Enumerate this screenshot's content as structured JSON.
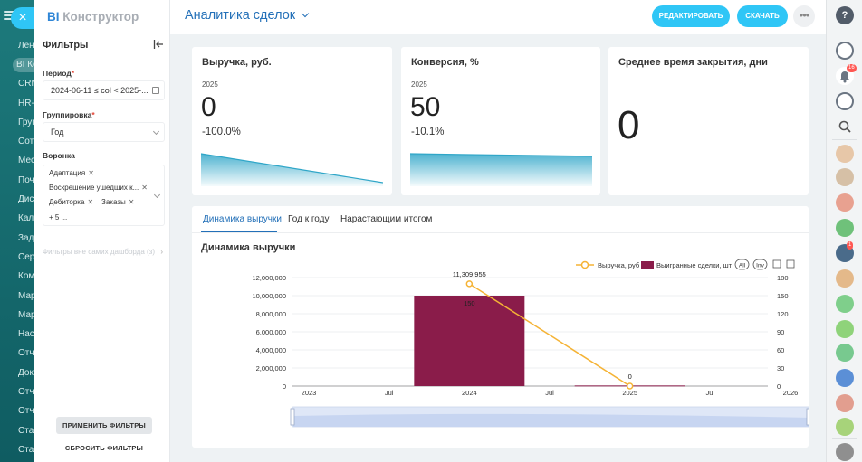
{
  "left_nav": {
    "items": [
      "Лент",
      "BI Ко",
      "CRM",
      "HR-А",
      "Груп",
      "Сотр",
      "Месс",
      "Почт",
      "Диск",
      "Кале",
      "Зада",
      "Серв",
      "Комп",
      "Марк",
      "Марк",
      "Наст",
      "Отче",
      "Доку",
      "Отче",
      "Отче",
      "Стан",
      "Стан"
    ],
    "active_index": 1
  },
  "close_button": "×",
  "filters": {
    "brand_prefix": "BI",
    "brand_name": "Конструктор",
    "title": "Фильтры",
    "period_label": "Период",
    "period_value": "2024-06-11 ≤ col < 2025-...",
    "grouping_label": "Группировка",
    "grouping_value": "Год",
    "funnel_label": "Воронка",
    "funnel_tags": [
      "Адаптация",
      "Воскрешение ушедших к...",
      "Дебиторка",
      "Заказы"
    ],
    "funnel_more": "+ 5 ...",
    "required_mark": "*",
    "outer_filters_text": "Фильтры вне самих дашборда (з)",
    "apply_button": "ПРИМЕНИТЬ ФИЛЬТРЫ",
    "reset_button": "СБРОСИТЬ ФИЛЬТРЫ"
  },
  "header": {
    "dashboard_title": "Аналитика сделок",
    "edit_button": "РЕДАКТИРОВАТЬ",
    "download_button": "СКАЧАТЬ",
    "more_button": "•••"
  },
  "kpi": [
    {
      "title": "Выручка, руб.",
      "year": "2025",
      "value": "0",
      "delta": "-100.0%",
      "spark": [
        1.0,
        0.0
      ]
    },
    {
      "title": "Конверсия, %",
      "year": "2025",
      "value": "50",
      "delta": "-10.1%",
      "spark": [
        1.0,
        0.91
      ]
    },
    {
      "title": "Среднее время закрытия, дни",
      "year": "",
      "value": "0",
      "delta": ""
    }
  ],
  "tabs": [
    "Динамика выручки",
    "Год к году",
    "Нарастающим итогом"
  ],
  "active_tab": 0,
  "chart_title": "Динамика выручки",
  "chart_data": {
    "type": "bar",
    "title": "Динамика выручки",
    "legend_position": "top-right",
    "legend_buttons": [
      "All",
      "Inv"
    ],
    "x_ticks": [
      "2023",
      "Jul",
      "2024",
      "Jul",
      "2025",
      "Jul",
      "2026"
    ],
    "y_left": {
      "min": 0,
      "max": 12000000,
      "ticks": [
        "0",
        "2,000,000",
        "4,000,000",
        "6,000,000",
        "8,000,000",
        "10,000,000",
        "12,000,000"
      ]
    },
    "y_right": {
      "min": 0,
      "max": 180,
      "ticks": [
        "0",
        "30",
        "60",
        "90",
        "120",
        "150",
        "180"
      ]
    },
    "series": [
      {
        "name": "Выручка, руб",
        "type": "line",
        "axis": "left",
        "color": "#f5b335",
        "points": [
          {
            "x": "2024",
            "y": 11309955,
            "label": "11,309,955"
          },
          {
            "x": "2025",
            "y": 0,
            "label": "0"
          }
        ]
      },
      {
        "name": "Выигранные сделки, шт",
        "type": "bar",
        "axis": "right",
        "color": "#8a1c4a",
        "points": [
          {
            "x": "2024",
            "y": 150,
            "label": "150"
          },
          {
            "x": "2025",
            "y": 1,
            "label": ""
          }
        ]
      }
    ],
    "grid": true
  },
  "rail": {
    "notifications_badge": "16",
    "avatar_badge": "1"
  },
  "colors": {
    "accent": "#2fc6f6",
    "title_blue": "#2370b8",
    "bar": "#8a1c4a",
    "line": "#f5b335",
    "spark": "#2fa6c8"
  }
}
